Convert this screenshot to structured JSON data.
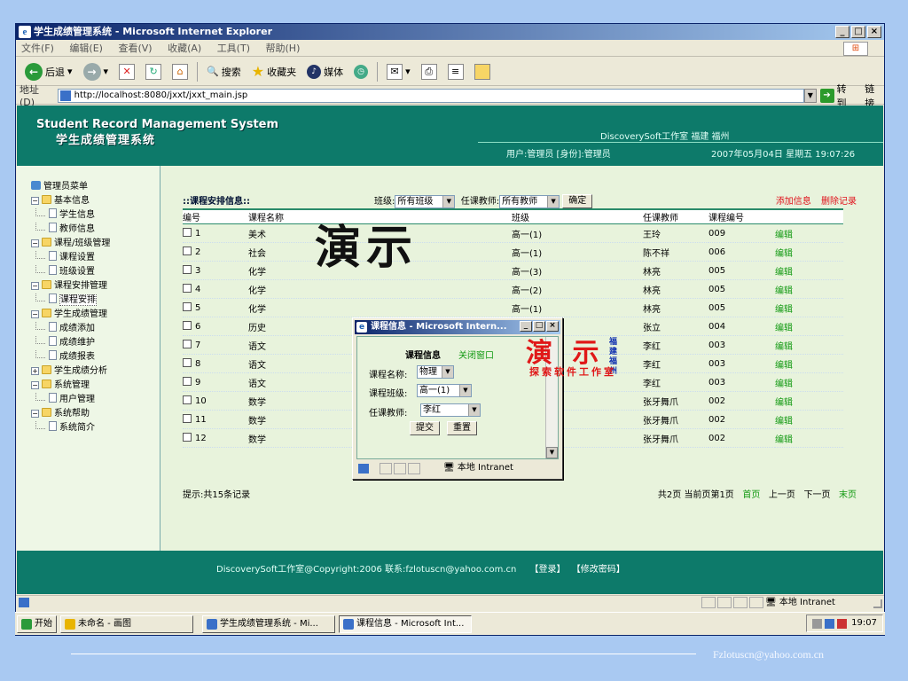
{
  "window": {
    "title": "学生成绩管理系统 - Microsoft Internet Explorer"
  },
  "menu": [
    "文件(F)",
    "编辑(E)",
    "查看(V)",
    "收藏(A)",
    "工具(T)",
    "帮助(H)"
  ],
  "toolbar": {
    "back": "后退",
    "search": "搜索",
    "favorites": "收藏夹",
    "media": "媒体"
  },
  "address": {
    "label": "地址(D)",
    "url": "http://localhost:8080/jxxt/jxxt_main.jsp",
    "go": "转到",
    "links": "链接"
  },
  "header": {
    "title_en": "Student Record Management System",
    "title_cn": "学生成绩管理系统",
    "studio": "DiscoverySoft工作室 福建 福州",
    "user": "用户:管理员 [身份]:管理员",
    "datetime": "2007年05月04日 星期五 19:07:26"
  },
  "sidebar": {
    "root": "管理员菜单",
    "groups": [
      {
        "label": "基本信息",
        "items": [
          "学生信息",
          "教师信息"
        ]
      },
      {
        "label": "课程/班级管理",
        "items": [
          "课程设置",
          "班级设置"
        ]
      },
      {
        "label": "课程安排管理",
        "items": [
          "课程安排"
        ]
      },
      {
        "label": "学生成绩管理",
        "items": [
          "成绩添加",
          "成绩维护",
          "成绩报表"
        ]
      },
      {
        "label": "学生成绩分析",
        "items": []
      },
      {
        "label": "系统管理",
        "items": [
          "用户管理"
        ]
      },
      {
        "label": "系统帮助",
        "items": [
          "系统简介"
        ]
      }
    ]
  },
  "filter": {
    "title": "::课程安排信息::",
    "class_label": "班级:",
    "class_value": "所有班级",
    "teacher_label": "任课教师:",
    "teacher_value": "所有教师",
    "ok": "确定",
    "add": "添加信息",
    "delete": "删除记录"
  },
  "table": {
    "headers": [
      "编号",
      "课程名称",
      "班级",
      "任课教师",
      "课程编号",
      ""
    ],
    "rows": [
      [
        "1",
        "美术",
        "高一(1)",
        "王玲",
        "009",
        "编辑"
      ],
      [
        "2",
        "社会",
        "高一(1)",
        "陈不祥",
        "006",
        "编辑"
      ],
      [
        "3",
        "化学",
        "高一(3)",
        "林亮",
        "005",
        "编辑"
      ],
      [
        "4",
        "化学",
        "高一(2)",
        "林亮",
        "005",
        "编辑"
      ],
      [
        "5",
        "化学",
        "高一(1)",
        "林亮",
        "005",
        "编辑"
      ],
      [
        "6",
        "历史",
        "",
        "张立",
        "004",
        "编辑"
      ],
      [
        "7",
        "语文",
        "",
        "李红",
        "003",
        "编辑"
      ],
      [
        "8",
        "语文",
        "",
        "李红",
        "003",
        "编辑"
      ],
      [
        "9",
        "语文",
        "",
        "李红",
        "003",
        "编辑"
      ],
      [
        "10",
        "数学",
        "",
        "张牙舞爪",
        "002",
        "编辑"
      ],
      [
        "11",
        "数学",
        "",
        "张牙舞爪",
        "002",
        "编辑"
      ],
      [
        "12",
        "数学",
        "",
        "张牙舞爪",
        "002",
        "编辑"
      ]
    ]
  },
  "pager": {
    "tip": "提示:共15条记录",
    "summary": "共2页 当前页第1页",
    "first": "首页",
    "prev": "上一页",
    "next": "下一页",
    "last": "末页"
  },
  "demo_text": "演示",
  "footer": {
    "copyright": "DiscoverySoft工作室@Copyright:2006 联系:fzlotuscn@yahoo.com.cn",
    "login": "【登录】",
    "change_pwd": "【修改密码】"
  },
  "statusbar": {
    "zone": "本地 Intranet"
  },
  "popup": {
    "title": "课程信息 - Microsoft Intern...",
    "heading": "课程信息",
    "close": "关闭窗口",
    "course_label": "课程名称:",
    "course_value": "物理",
    "class_label": "课程班级:",
    "class_value": "高一(1)",
    "teacher_label": "任课教师:",
    "teacher_value": "李红",
    "submit": "提交",
    "reset": "重置",
    "zone": "本地 Intranet"
  },
  "stamp": {
    "big": "演 示",
    "city1": "福建",
    "city2": "福州",
    "sub": "探索软件工作室"
  },
  "taskbar": {
    "start": "开始",
    "tasks": [
      "未命名 - 画图",
      "学生成绩管理系统 - Mi...",
      "课程信息 - Microsoft Int..."
    ],
    "time": "19:07"
  },
  "slide_email": "Fzlotuscn@yahoo.com.cn"
}
